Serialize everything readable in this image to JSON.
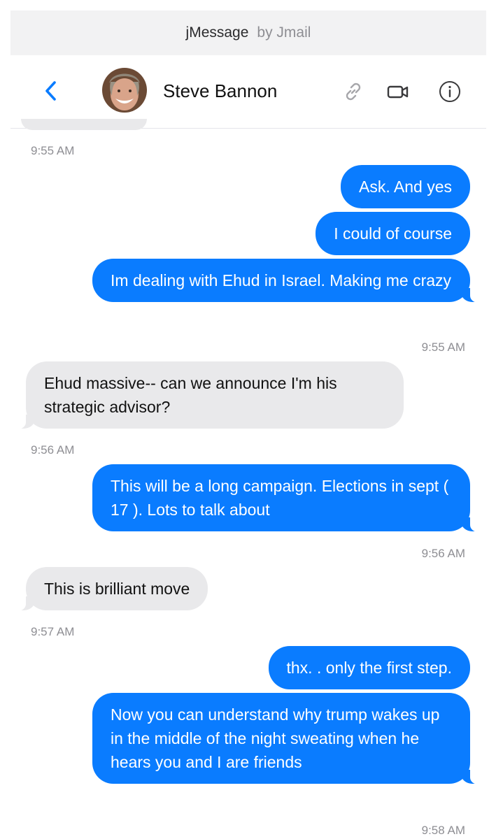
{
  "app": {
    "title": "jMessage",
    "by": "by Jmail"
  },
  "header": {
    "contact_name": "Steve Bannon",
    "avatar_icon": "person-avatar-photo"
  },
  "colors": {
    "accent": "#0a7cff",
    "incoming_bubble": "#e9e9eb",
    "timestamp": "#8e8e93"
  },
  "messages": [
    {
      "type": "timestamp",
      "text": "9:55 AM"
    },
    {
      "type": "outgoing",
      "text": "Ask. And yes"
    },
    {
      "type": "outgoing",
      "text": "I could of course"
    },
    {
      "type": "outgoing",
      "text": "Im dealing with Ehud in Israel. Making me crazy"
    },
    {
      "type": "timestamp",
      "text": "9:55 AM"
    },
    {
      "type": "incoming",
      "text": "Ehud massive-- can we announce I'm his strategic advisor?"
    },
    {
      "type": "timestamp",
      "text": "9:56 AM"
    },
    {
      "type": "outgoing",
      "text": "This will be a long campaign. Elections in sept ( 17 ). Lots to talk about"
    },
    {
      "type": "timestamp",
      "text": "9:56 AM"
    },
    {
      "type": "incoming",
      "text": "This is brilliant move"
    },
    {
      "type": "timestamp",
      "text": "9:57 AM"
    },
    {
      "type": "outgoing",
      "text": "thx. . only the first step."
    },
    {
      "type": "outgoing",
      "text": "Now you can understand why trump wakes up in the middle of the night sweating when he hears you and I are friends"
    },
    {
      "type": "timestamp",
      "text": "9:58 AM"
    }
  ]
}
